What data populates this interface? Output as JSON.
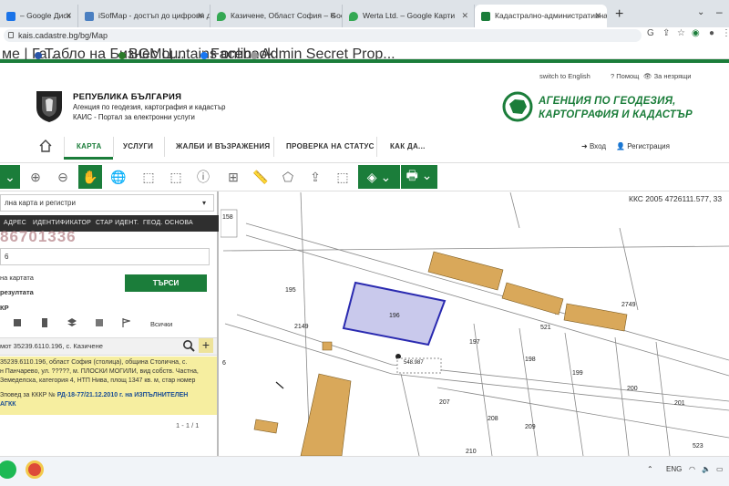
{
  "browser": {
    "tabs": [
      {
        "label": "– Google Диск",
        "color": "#1a73e8"
      },
      {
        "label": "iSofMap - достъп до цифрови д",
        "color": "#4a7fc1"
      },
      {
        "label": "Казичене, Област София – Goog",
        "color": "#34a853"
      },
      {
        "label": "Werta Ltd. – Google Карти",
        "color": "#34a853"
      },
      {
        "label": "Кадастрално-административна",
        "color": "#1b7d3a"
      }
    ],
    "new_tab": "+",
    "url": "kais.cadastre.bg/bg/Map",
    "bookmarks": [
      {
        "label": "ме | Га...",
        "color": "#888"
      },
      {
        "label": "Табло на Бизнес Ц...",
        "color": "#2a55a8"
      },
      {
        "label": "BGMountains onlin...",
        "color": "#2a7a2a"
      },
      {
        "label": "Facebook",
        "color": "#1877f2"
      },
      {
        "label": "Admin Secret Prop...",
        "color": "#999"
      }
    ]
  },
  "site": {
    "top_links": {
      "english": "switch to English",
      "help": "Помощ",
      "low_vision": "За незрящи"
    },
    "republic": "РЕПУБЛИКА БЪЛГАРИЯ",
    "agency_sub": "Агенция по геодезия, картография и кадастър",
    "portal_sub": "КАИС - Портал за електронни услуги",
    "agency_line1": "АГЕНЦИЯ ПО ГЕОДЕЗИЯ,",
    "agency_line2": "КАРТОГРАФИЯ И КАДАСТЪР",
    "nav": [
      "КАРТА",
      "УСЛУГИ",
      "ЖАЛБИ И ВЪЗРАЖЕНИЯ",
      "ПРОВЕРКА НА СТАТУС",
      "КАК ДА..."
    ],
    "login": "Вход",
    "register": "Регистрация"
  },
  "panel": {
    "layer_select": "лна карта и регистри",
    "search_tabs": [
      "АДРЕС",
      "ИДЕНТИФИКАТОР",
      "СТАР ИДЕНТ.",
      "ГЕОД. ОСНОВА"
    ],
    "parcel_number": "86701336",
    "input_value": "6",
    "label_on_map": "на картата",
    "label_results": "резултата",
    "search_button": "ТЪРСИ",
    "label_kkr": "КР",
    "label_all": "Всички",
    "result_title": "мот 35239.6110.196, с. Казичене",
    "result_lines": [
      "35239.6110.196, област София (столица), община Столична, с.",
      "н Панчарево, ул. ?????, м. ПЛОСКИ МОГИЛИ, вид собств. Частна,",
      "Земеделска, категория 4, НТП Нива, площ 1347 кв. м, стар номер"
    ],
    "order_prefix": "Зповед за КККР №",
    "order_number": "РД-18-77/21.12.2010 г.",
    "order_suffix": "на ИЗПЪЛНИТЕЛЕН",
    "order_line2": "АГКК",
    "pager": "1 - 1 / 1"
  },
  "map": {
    "kks_readout": "ККС 2005 4726111.577, 33",
    "parcel_labels": [
      "195",
      "196",
      "197",
      "198",
      "199",
      "200",
      "201",
      "207",
      "208",
      "209",
      "210",
      "521",
      "523",
      "2149",
      "2749",
      "6",
      "158"
    ],
    "point_label": "548.987",
    "highlight_color": "#c9c9ec",
    "building_color": "#d9a85a"
  },
  "taskbar": {
    "lang": "ENG"
  }
}
